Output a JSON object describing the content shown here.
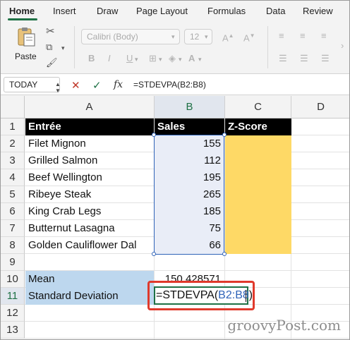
{
  "ribbon": {
    "tabs": [
      "Home",
      "Insert",
      "Draw",
      "Page Layout",
      "Formulas",
      "Data",
      "Review"
    ],
    "paste_label": "Paste",
    "font_name": "Calibri (Body)",
    "font_size": "12",
    "bold": "B",
    "italic": "I",
    "underline": "U"
  },
  "formula_bar": {
    "name_box": "TODAY",
    "cancel_glyph": "✕",
    "enter_glyph": "✓",
    "fx_label": "fx",
    "formula": "=STDEVPA(B2:B8)"
  },
  "sheet": {
    "columns": [
      "A",
      "B",
      "C",
      "D"
    ],
    "rows": [
      "1",
      "2",
      "3",
      "4",
      "5",
      "6",
      "7",
      "8",
      "9",
      "10",
      "11",
      "12",
      "13"
    ],
    "headers": {
      "a": "Entrée",
      "b": "Sales",
      "c": "Z-Score"
    },
    "data": [
      {
        "entree": "Filet Mignon",
        "sales": "155"
      },
      {
        "entree": "Grilled Salmon",
        "sales": "112"
      },
      {
        "entree": "Beef Wellington",
        "sales": "195"
      },
      {
        "entree": "Ribeye Steak",
        "sales": "265"
      },
      {
        "entree": "King Crab Legs",
        "sales": "185"
      },
      {
        "entree": "Butternut Lasagna",
        "sales": "75"
      },
      {
        "entree": "Golden Cauliflower Dal",
        "sales": "66"
      }
    ],
    "mean_label": "Mean",
    "mean_value": "150.428571",
    "stdev_label": "Standard Deviation",
    "edit_prefix": "=STDEVPA(",
    "edit_ref": "B2:B8",
    "edit_suffix": ")"
  },
  "colors": {
    "accent_green": "#1e7145",
    "range_blue": "#2f63b8",
    "zscore_yellow": "#fed966",
    "label_blue": "#bdd7ee",
    "callout_red": "#e03a2c"
  },
  "watermark": "groovyPost.com"
}
